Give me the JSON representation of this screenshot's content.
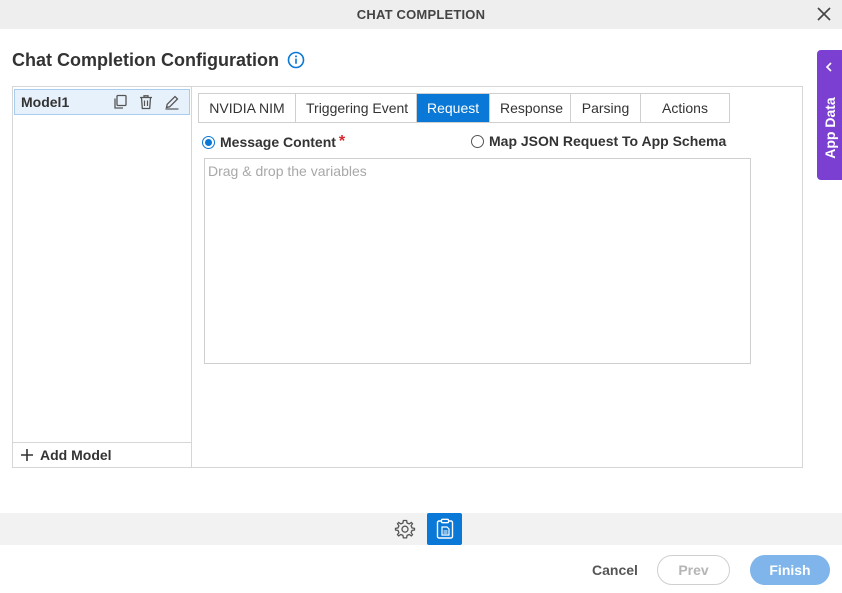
{
  "window": {
    "title": "CHAT COMPLETION"
  },
  "heading": {
    "text": "Chat Completion Configuration"
  },
  "side_panel": {
    "label": "App Data"
  },
  "models": {
    "items": [
      {
        "name": "Model1"
      }
    ],
    "add_label": "Add Model"
  },
  "tabs": [
    {
      "label": "NVIDIA NIM",
      "active": false
    },
    {
      "label": "Triggering Event",
      "active": false
    },
    {
      "label": "Request",
      "active": true
    },
    {
      "label": "Response",
      "active": false
    },
    {
      "label": "Parsing",
      "active": false
    },
    {
      "label": "Actions",
      "active": false
    }
  ],
  "request": {
    "option_message": "Message Content",
    "required_mark": "*",
    "option_map": "Map JSON Request To App Schema",
    "selected": "message",
    "placeholder": "Drag & drop the variables"
  },
  "footer": {
    "cancel": "Cancel",
    "prev": "Prev",
    "finish": "Finish"
  },
  "colors": {
    "accent": "#0a78d6",
    "side_panel": "#7b3fd1",
    "required": "#d9262c"
  }
}
